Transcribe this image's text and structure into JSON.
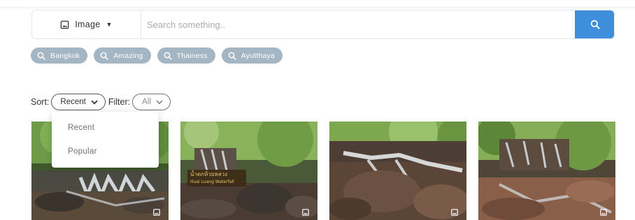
{
  "search": {
    "type_label": "Image",
    "placeholder": "Search something.."
  },
  "tags": [
    {
      "label": "Bangkok"
    },
    {
      "label": "Amazing"
    },
    {
      "label": "Thainess"
    },
    {
      "label": "Ayutthaya"
    }
  ],
  "controls": {
    "sort_label": "Sort:",
    "sort_value": "Recent",
    "filter_label": "Filter:",
    "filter_value": "All"
  },
  "sort_menu": {
    "options": [
      "Recent",
      "Popular"
    ]
  },
  "photos": [
    {
      "subject": "waterfall"
    },
    {
      "subject": "waterfall",
      "sign_line1": "น้ำตกห้วยหลวง",
      "sign_line2": "Huai Luang Waterfall"
    },
    {
      "subject": "waterfall"
    },
    {
      "subject": "waterfall"
    }
  ],
  "colors": {
    "accent": "#3d8fdb",
    "tag_bg": "#a4b5c3",
    "border": "#e3e6ea"
  },
  "icons": {
    "type_select": "image-icon",
    "search_button": "search-icon",
    "tag": "search-icon",
    "photo_corner": "image-icon",
    "chevron": "chevron-down-icon"
  }
}
